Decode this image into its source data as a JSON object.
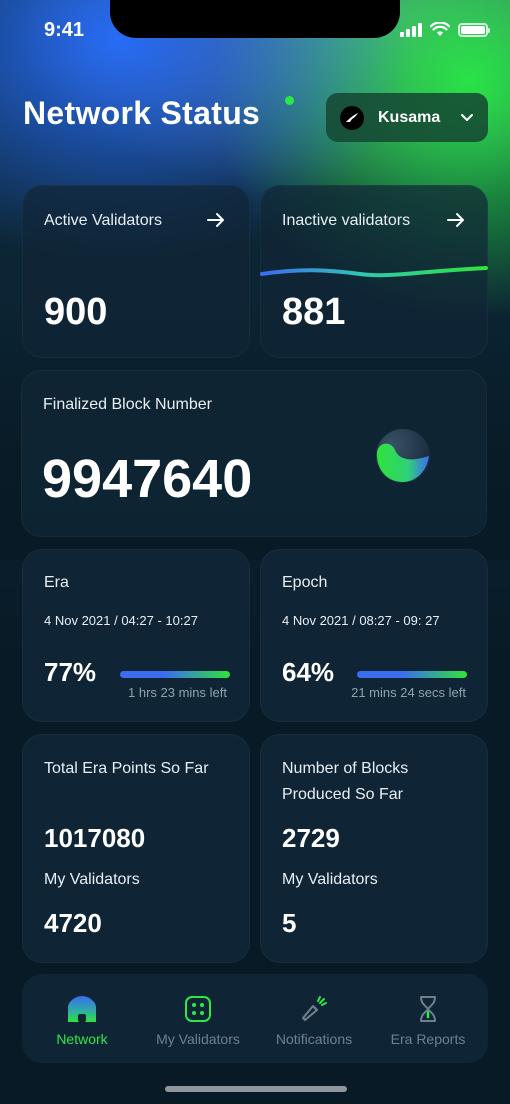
{
  "status_bar": {
    "time": "9:41"
  },
  "header": {
    "title": "Network Status",
    "network": "Kusama"
  },
  "active_validators": {
    "label": "Active Validators",
    "value": "900"
  },
  "inactive_validators": {
    "label": "Inactive validators",
    "value": "881"
  },
  "finalized_block": {
    "label": "Finalized Block Number",
    "value": "9947640"
  },
  "era": {
    "label": "Era",
    "range": "4 Nov 2021 / 04:27 - 10:27",
    "percent": "77%",
    "progress": 0.77,
    "remaining": "1 hrs 23 mins left"
  },
  "epoch": {
    "label": "Epoch",
    "range": "4 Nov 2021 / 08:27 - 09: 27",
    "percent": "64%",
    "progress": 0.64,
    "remaining": "21 mins 24 secs left"
  },
  "era_points": {
    "label": "Total Era Points So Far",
    "value": "1017080",
    "my_label": "My Validators",
    "my_value": "4720"
  },
  "blocks_produced": {
    "label_line1": "Number of Blocks",
    "label_line2": "Produced So Far",
    "value": "2729",
    "my_label": "My Validators",
    "my_value": "5"
  },
  "nav": {
    "items": [
      {
        "label": "Network",
        "icon": "home-icon",
        "active": true
      },
      {
        "label": "My Validators",
        "icon": "validators-icon",
        "active": false
      },
      {
        "label": "Notifications",
        "icon": "megaphone-icon",
        "active": false
      },
      {
        "label": "Era Reports",
        "icon": "hourglass-icon",
        "active": false
      }
    ]
  },
  "colors": {
    "accent_green": "#2ee84a",
    "accent_blue": "#3b6cf0",
    "card": "#0f2535"
  }
}
